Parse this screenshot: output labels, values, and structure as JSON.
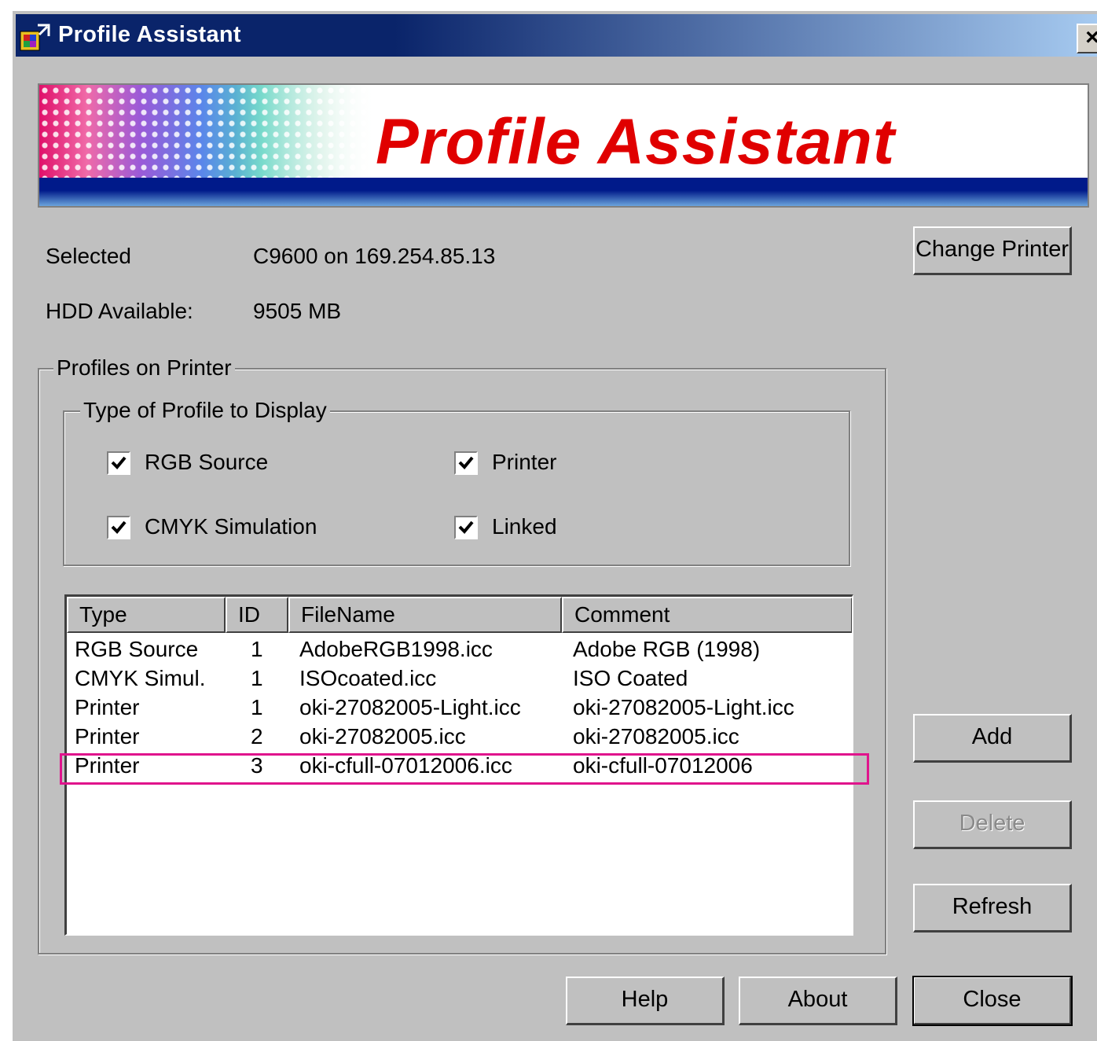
{
  "window": {
    "title": "Profile Assistant",
    "close_label": "×"
  },
  "banner": {
    "title": "Profile Assistant"
  },
  "info": {
    "selected_label": "Selected",
    "selected_value": "C9600 on 169.254.85.13",
    "hdd_label": "HDD Available:",
    "hdd_value": "9505 MB"
  },
  "buttons": {
    "change_printer": "Change Printer",
    "add": "Add",
    "delete": "Delete",
    "refresh": "Refresh",
    "help": "Help",
    "about": "About",
    "close": "Close"
  },
  "profiles_group": {
    "legend": "Profiles on Printer"
  },
  "type_group": {
    "legend": "Type of Profile to Display",
    "options": [
      {
        "label": "RGB Source",
        "checked": true
      },
      {
        "label": "Printer",
        "checked": true
      },
      {
        "label": "CMYK Simulation",
        "checked": true
      },
      {
        "label": "Linked",
        "checked": true
      }
    ]
  },
  "table": {
    "columns": [
      "Type",
      "ID",
      "FileName",
      "Comment"
    ],
    "rows": [
      {
        "type": "RGB Source",
        "id": "1",
        "filename": "AdobeRGB1998.icc",
        "comment": "Adobe RGB (1998)"
      },
      {
        "type": "CMYK Simul.",
        "id": "1",
        "filename": "ISOcoated.icc",
        "comment": "ISO Coated"
      },
      {
        "type": "Printer",
        "id": "1",
        "filename": "oki-27082005-Light.icc",
        "comment": "oki-27082005-Light.icc"
      },
      {
        "type": "Printer",
        "id": "2",
        "filename": "oki-27082005.icc",
        "comment": "oki-27082005.icc"
      },
      {
        "type": "Printer",
        "id": "3",
        "filename": "oki-cfull-07012006.icc",
        "comment": "oki-cfull-07012006"
      }
    ],
    "highlighted_row": 4
  },
  "colors": {
    "titlebar": "#0a246a",
    "banner_title": "#e00000",
    "highlight": "#e0148c",
    "face": "#c0c0c0"
  }
}
